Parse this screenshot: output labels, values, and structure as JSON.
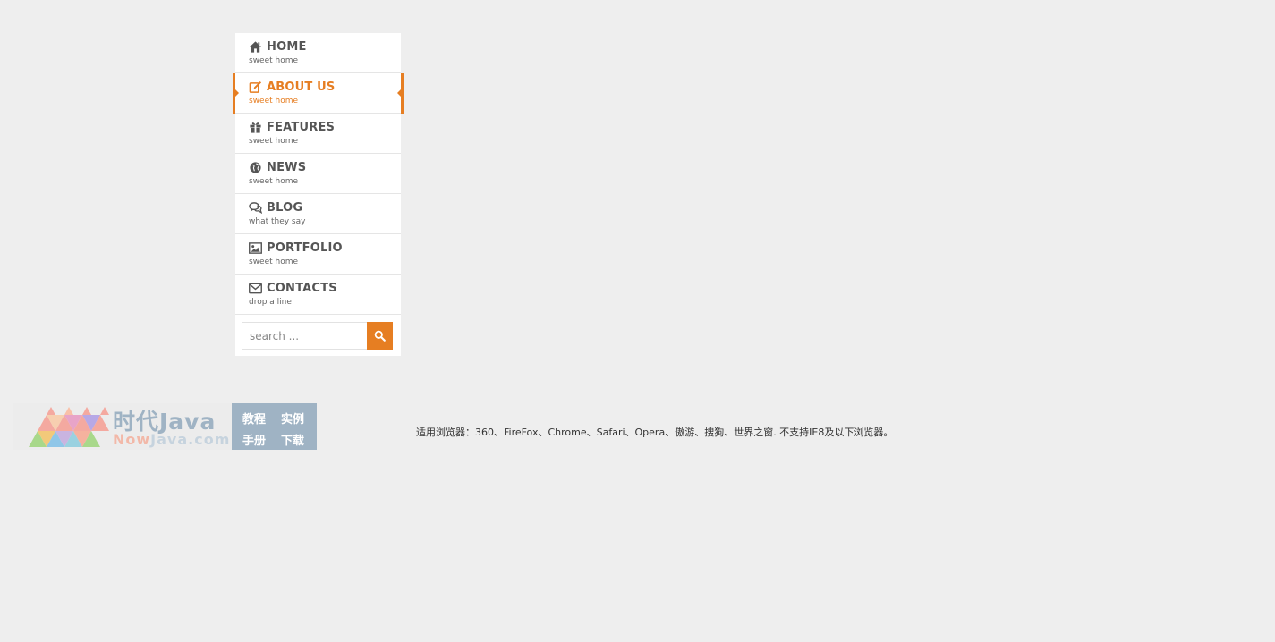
{
  "menu": {
    "items": [
      {
        "label": "HOME",
        "sub": "sweet home",
        "icon": "home-icon"
      },
      {
        "label": "ABOUT US",
        "sub": "sweet home",
        "icon": "edit-icon",
        "active": true
      },
      {
        "label": "FEATURES",
        "sub": "sweet home",
        "icon": "gift-icon"
      },
      {
        "label": "NEWS",
        "sub": "sweet home",
        "icon": "globe-icon"
      },
      {
        "label": "BLOG",
        "sub": "what they say",
        "icon": "comments-icon"
      },
      {
        "label": "PORTFOLIO",
        "sub": "sweet home",
        "icon": "picture-icon"
      },
      {
        "label": "CONTACTS",
        "sub": "drop a line",
        "icon": "envelope-icon"
      }
    ]
  },
  "search": {
    "placeholder": "search ...",
    "value": "",
    "button_icon": "search-icon"
  },
  "logo": {
    "cn_name": "时代Java",
    "en_prefix": "Now",
    "en_suffix": "Java.com",
    "box_words": [
      "教程",
      "实例",
      "手册",
      "下载"
    ]
  },
  "footer_note": "适用浏览器：360、FireFox、Chrome、Safari、Opera、傲游、搜狗、世界之窗. 不支持IE8及以下浏览器。",
  "colors": {
    "accent": "#e67e22",
    "text": "#555555",
    "background": "#eeeeee",
    "logo_blue": "#9fb3c4"
  }
}
